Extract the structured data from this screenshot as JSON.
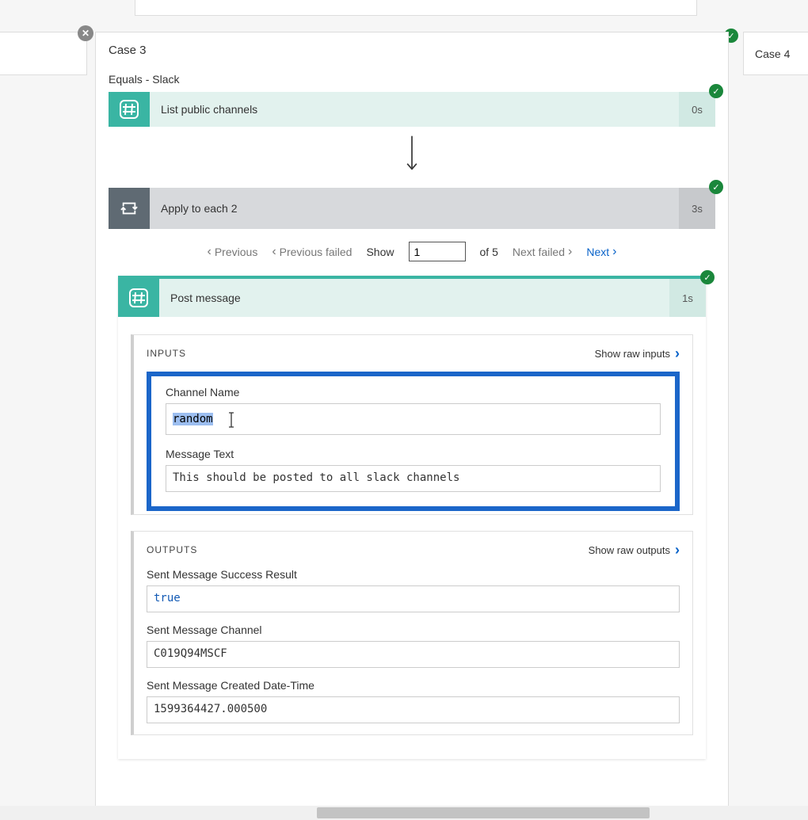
{
  "case_right": {
    "title": "Case 4"
  },
  "case": {
    "title": "Case 3",
    "condition": "Equals - Slack"
  },
  "steps": {
    "list_channels": {
      "title": "List public channels",
      "duration": "0s"
    },
    "apply_each": {
      "title": "Apply to each 2",
      "duration": "3s"
    },
    "post_message": {
      "title": "Post message",
      "duration": "1s"
    }
  },
  "pager": {
    "prev": "Previous",
    "prev_failed": "Previous failed",
    "show": "Show",
    "value": "1",
    "of": "of 5",
    "next_failed": "Next failed",
    "next": "Next"
  },
  "sections": {
    "inputs_label": "INPUTS",
    "show_raw_inputs": "Show raw inputs",
    "outputs_label": "OUTPUTS",
    "show_raw_outputs": "Show raw outputs"
  },
  "inputs": {
    "channel_name_label": "Channel Name",
    "channel_name_value": "random",
    "message_text_label": "Message Text",
    "message_text_value": "This should be posted to all slack channels"
  },
  "outputs": {
    "success_label": "Sent Message Success Result",
    "success_value": "true",
    "channel_label": "Sent Message Channel",
    "channel_value": "C019Q94MSCF",
    "created_label": "Sent Message Created Date-Time",
    "created_value": "1599364427.000500"
  }
}
